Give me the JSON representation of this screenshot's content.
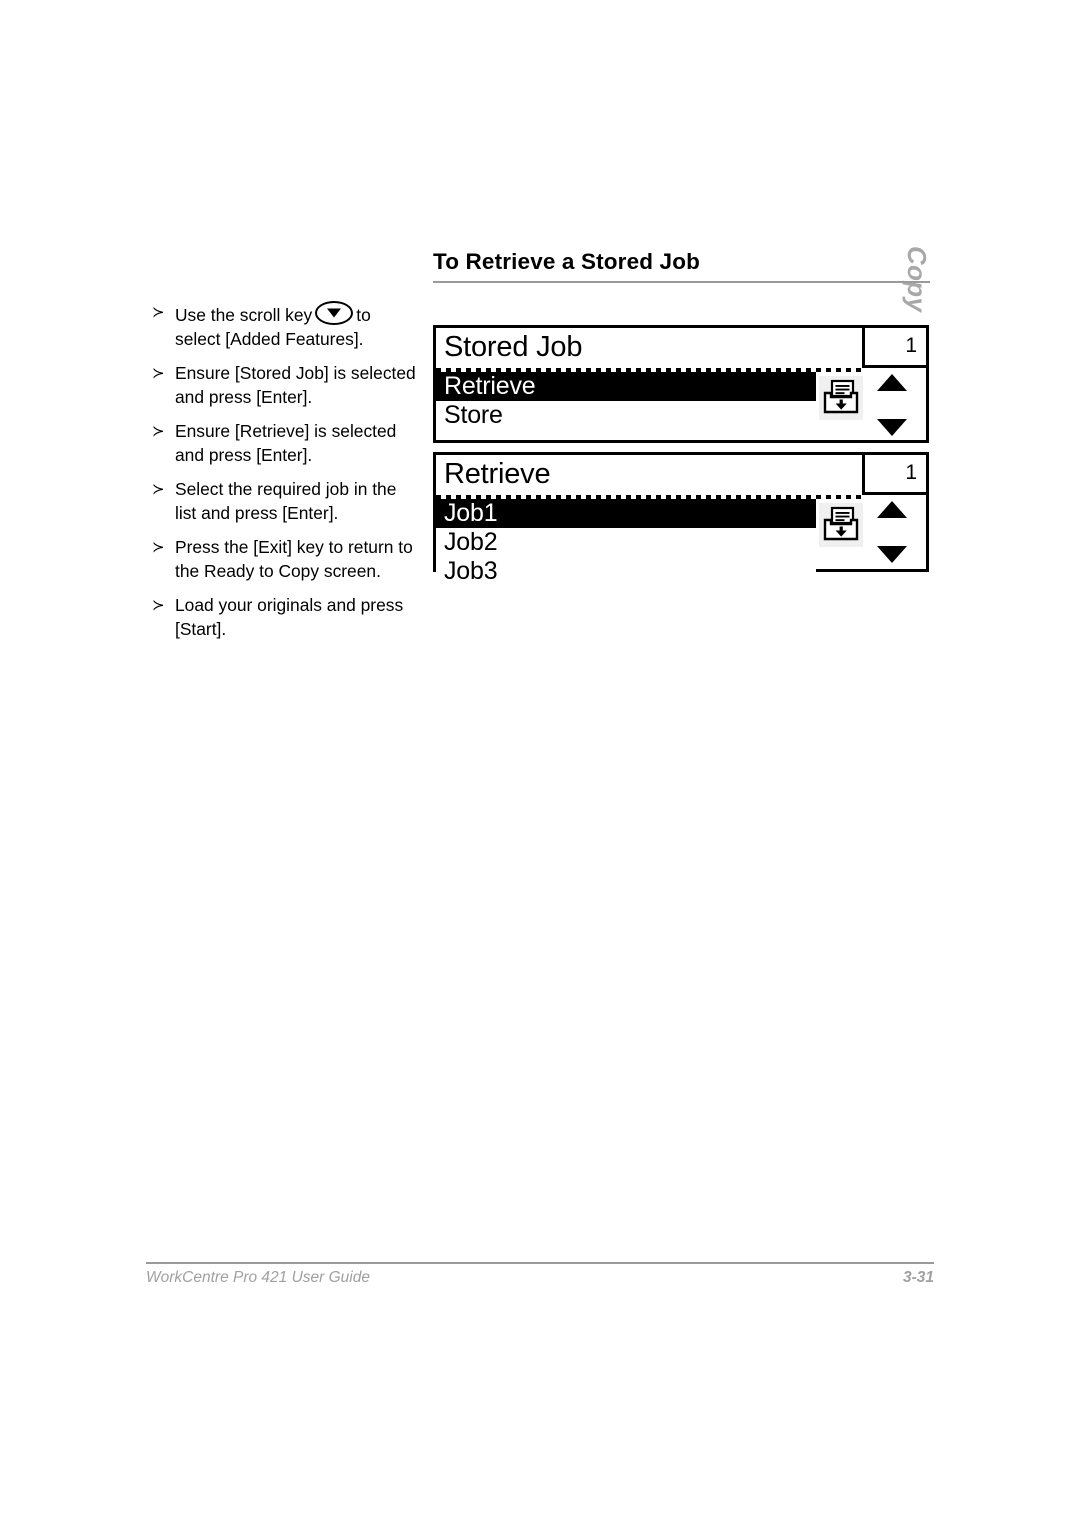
{
  "page": {
    "side_tab_label": "Copy",
    "section_title": "To Retrieve a Stored Job"
  },
  "steps": [
    {
      "marker": "≻",
      "text_before": "Use the scroll key",
      "icon": "scroll-down-key-icon",
      "text_after": "to select [Added Features]."
    },
    {
      "marker": "≻",
      "text_before": "Ensure [Stored Job] is selected and press [Enter].",
      "icon": "",
      "text_after": ""
    },
    {
      "marker": "≻",
      "text_before": "Ensure [Retrieve] is selected and press [Enter].",
      "icon": "",
      "text_after": ""
    },
    {
      "marker": "≻",
      "text_before": "Select the required job in the list and press [Enter].",
      "icon": "",
      "text_after": ""
    },
    {
      "marker": "≻",
      "text_before": "Press the [Exit] key to return to the Ready to Copy screen.",
      "icon": "",
      "text_after": ""
    },
    {
      "marker": "≻",
      "text_before": "Load your originals and press [Start].",
      "icon": "",
      "text_after": ""
    }
  ],
  "panels": [
    {
      "id": "stored-job",
      "title": "Stored Job",
      "count": "1",
      "icon": "job-tray-download-icon",
      "up_arrow": "scroll-up-arrow-icon",
      "down_arrow": "scroll-down-arrow-icon",
      "rows": [
        {
          "label": "Retrieve",
          "selected": true
        },
        {
          "label": "Store",
          "selected": false
        }
      ]
    },
    {
      "id": "retrieve",
      "title": "Retrieve",
      "count": "1",
      "icon": "job-tray-download-icon",
      "up_arrow": "scroll-up-arrow-icon",
      "down_arrow": "scroll-down-arrow-icon",
      "rows": [
        {
          "label": "Job1",
          "selected": true
        },
        {
          "label": "Job2",
          "selected": false
        },
        {
          "label": "Job3",
          "selected": false
        }
      ]
    }
  ],
  "footer": {
    "left": "WorkCentre Pro 421 User Guide",
    "right": "3-31"
  },
  "colors": {
    "rule_gray": "#9a9a9a",
    "footer_gray": "#a0a0a0",
    "tab_gray": "#a8a8a8",
    "ink_black": "#000000",
    "paper_white": "#ffffff"
  }
}
